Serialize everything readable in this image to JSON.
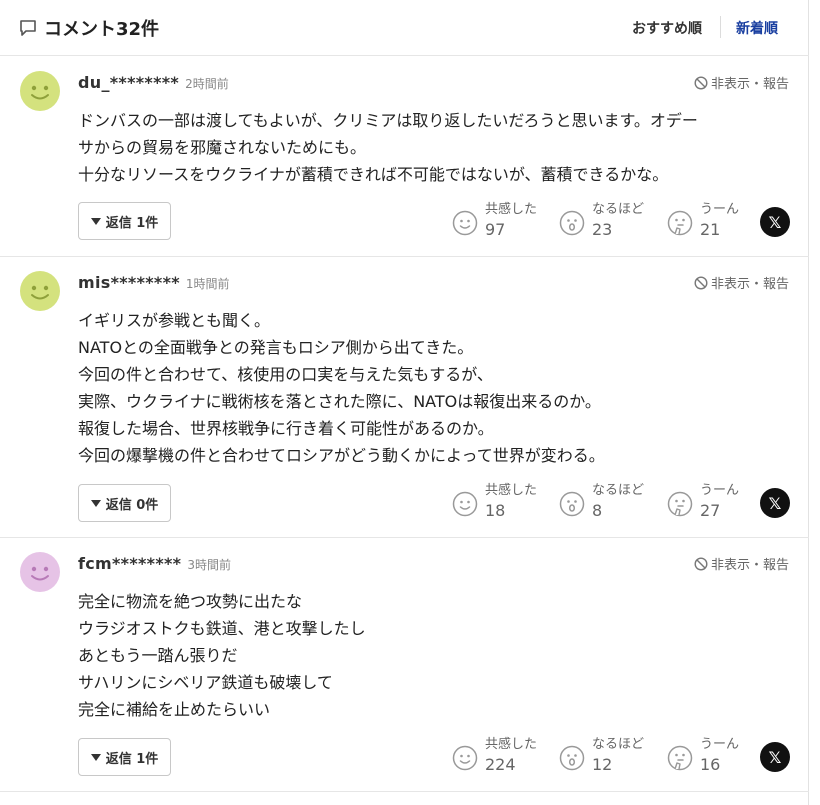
{
  "header": {
    "title": "コメント32件",
    "sort_recommended": "おすすめ順",
    "sort_new": "新着順"
  },
  "labels": {
    "report": "非表示・報告",
    "empathy": "共感した",
    "insight": "なるほど",
    "hmm": "うーん",
    "x_logo": "𝕏"
  },
  "comments": [
    {
      "user": "du_********",
      "time": "2時間前",
      "lines": [
        "ドンバスの一部は渡してもよいが、クリミアは取り返したいだろうと思います。オデー",
        "サからの貿易を邪魔されないためにも。",
        "十分なリソースをウクライナが蓄積できれば不可能ではないが、蓄積できるかな。"
      ],
      "reply": "返信 1件",
      "empathy": "97",
      "insight": "23",
      "hmm": "21",
      "avatar_color": "#d4e27e"
    },
    {
      "user": "mis********",
      "time": "1時間前",
      "lines": [
        "イギリスが参戦とも聞く。",
        "NATOとの全面戦争との発言もロシア側から出てきた。",
        "今回の件と合わせて、核使用の口実を与えた気もするが、",
        "実際、ウクライナに戦術核を落とされた際に、NATOは報復出来るのか。",
        "報復した場合、世界核戦争に行き着く可能性があるのか。",
        "今回の爆撃機の件と合わせてロシアがどう動くかによって世界が変わる。"
      ],
      "reply": "返信 0件",
      "empathy": "18",
      "insight": "8",
      "hmm": "27",
      "avatar_color": "#d4e27e"
    },
    {
      "user": "fcm********",
      "time": "3時間前",
      "lines": [
        "完全に物流を絶つ攻勢に出たな",
        "ウラジオストクも鉄道、港と攻撃したし",
        "あともう一踏ん張りだ",
        "サハリンにシベリア鉄道も破壊して",
        "完全に補給を止めたらいい"
      ],
      "reply": "返信 1件",
      "empathy": "224",
      "insight": "12",
      "hmm": "16",
      "avatar_color": "#e6c3e6"
    }
  ]
}
